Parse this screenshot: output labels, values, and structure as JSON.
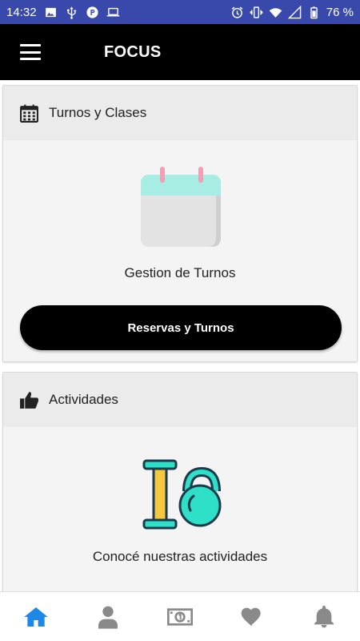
{
  "status_bar": {
    "time": "14:32",
    "battery": "76 %",
    "left_icons": [
      "image-icon",
      "usb-icon",
      "parking-icon",
      "laptop-icon"
    ],
    "right_icons": [
      "alarm-icon",
      "vibrate-icon",
      "wifi-icon",
      "signal-icon",
      "battery-icon"
    ]
  },
  "app_bar": {
    "title": "FOCUS",
    "menu_icon": "hamburger-menu-icon"
  },
  "cards": {
    "turnos": {
      "title": "Turnos y Clases",
      "header_icon": "calendar-icon",
      "illustration": "calendar-illustration",
      "caption": "Gestion de Turnos",
      "button_label": "Reservas y Turnos"
    },
    "actividades": {
      "title": "Actividades",
      "header_icon": "thumbs-up-icon",
      "illustration": "dumbbell-kettlebell-illustration",
      "caption": "Conocé nuestras actividades"
    }
  },
  "bottom_nav": {
    "items": [
      "home-icon",
      "profile-icon",
      "payments-icon",
      "favorites-icon",
      "notifications-icon"
    ],
    "active": "home-icon"
  },
  "colors": {
    "status_bar": "#3949ab",
    "app_bar": "#000000",
    "accent": "#1e88e5",
    "nav_inactive": "#8a8a8a",
    "illustration_teal": "#2ee0c8",
    "illustration_yellow": "#f5c842",
    "calendar_top": "#a8ede3",
    "calendar_pin": "#f0a0b0"
  }
}
